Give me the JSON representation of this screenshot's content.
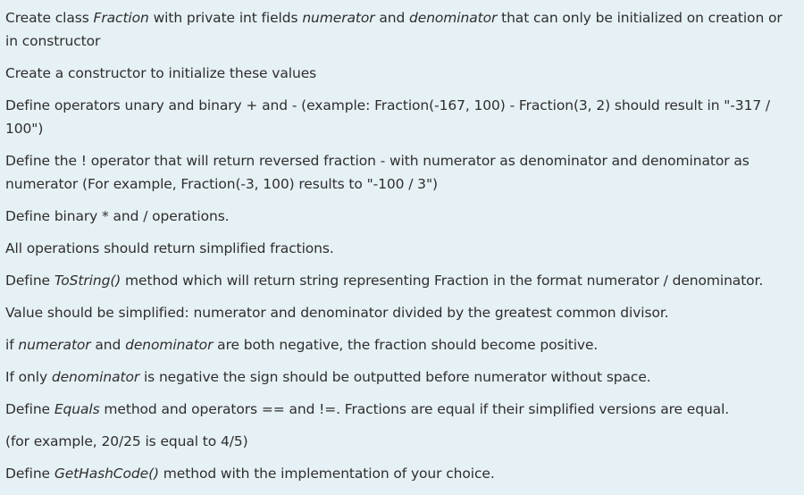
{
  "paragraphs": [
    [
      {
        "t": "Create class "
      },
      {
        "t": "Fraction",
        "i": true
      },
      {
        "t": " with private int fields "
      },
      {
        "t": "numerator",
        "i": true
      },
      {
        "t": " and "
      },
      {
        "t": "denominator",
        "i": true
      },
      {
        "t": " that can only be initialized on creation or in constructor"
      }
    ],
    [
      {
        "t": "Create a constructor to initialize these values"
      }
    ],
    [
      {
        "t": "Define operators unary and binary + and - (example: Fraction(-167, 100) - Fraction(3, 2) should result in \"-317 / 100\")"
      }
    ],
    [
      {
        "t": "Define the ! operator that will return reversed fraction - with numerator as denominator and denominator as numerator (For example, Fraction(-3, 100) results to \"-100 / 3\")"
      }
    ],
    [
      {
        "t": "Define binary  * and / operations."
      }
    ],
    [
      {
        "t": "All operations should return simplified fractions."
      }
    ],
    [
      {
        "t": "Define "
      },
      {
        "t": "ToString()",
        "i": true
      },
      {
        "t": " method which will return string representing Fraction in the format numerator / denominator."
      }
    ],
    [
      {
        "t": "Value should be simplified: numerator and denominator divided by the greatest common divisor."
      }
    ],
    [
      {
        "t": "if  "
      },
      {
        "t": "numerator",
        "i": true
      },
      {
        "t": " and "
      },
      {
        "t": "denominator",
        "i": true
      },
      {
        "t": " are both negative, the fraction should become positive."
      }
    ],
    [
      {
        "t": "If only "
      },
      {
        "t": "denominator",
        "i": true
      },
      {
        "t": " is negative the sign should be outputted before numerator without space."
      }
    ],
    [
      {
        "t": "Define "
      },
      {
        "t": "Equals",
        "i": true
      },
      {
        "t": " method and operators == and !=. Fractions are equal if their simplified versions are equal."
      }
    ],
    [
      {
        "t": "(for example, 20/25 is equal to 4/5)"
      }
    ],
    [
      {
        "t": "Define "
      },
      {
        "t": "GetHashCode()",
        "i": true
      },
      {
        "t": " method with the implementation of your choice."
      }
    ]
  ]
}
